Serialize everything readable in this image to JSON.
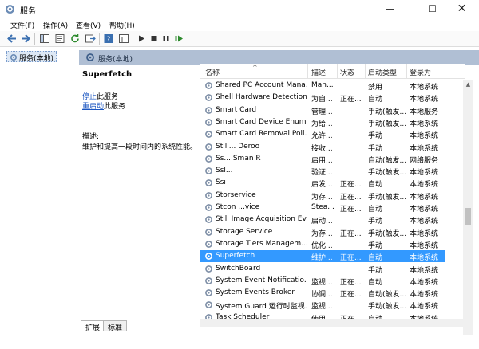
{
  "window": {
    "title": "服务",
    "min": "—",
    "max": "☐",
    "close": "✕"
  },
  "menu": [
    "文件(F)",
    "操作(A)",
    "查看(V)",
    "帮助(H)"
  ],
  "toolbar": {
    "icons": [
      "back-icon",
      "forward-icon",
      "console-tree-icon",
      "properties-icon",
      "refresh-icon",
      "export-icon",
      "help-icon",
      "view-icon",
      "start-icon",
      "stop-icon",
      "pause-icon",
      "restart-icon"
    ]
  },
  "tree": {
    "item": "服务(本地)"
  },
  "pane": {
    "header": "服务(本地)"
  },
  "details": {
    "title": "Superfetch",
    "stop_link": "停止",
    "stop_suffix": "此服务",
    "restart_link": "重启动",
    "restart_suffix": "此服务",
    "desc_label": "描述:",
    "desc_text": "维护和提高一段时间内的系统性能。"
  },
  "columns": {
    "name": "名称",
    "desc": "描述",
    "status": "状态",
    "startup": "启动类型",
    "logon": "登录为"
  },
  "rows": [
    {
      "name": "Shared PC Account Mana...",
      "desc": "Man...",
      "status": "",
      "startup": "禁用",
      "logon": "本地系统"
    },
    {
      "name": "Shell Hardware Detection",
      "desc": "为自...",
      "status": "正在...",
      "startup": "自动",
      "logon": "本地系统"
    },
    {
      "name": "Smart Card",
      "desc": "管理...",
      "status": "",
      "startup": "手动(触发...",
      "logon": "本地服务"
    },
    {
      "name": "Smart Card Device Enum...",
      "desc": "为给...",
      "status": "",
      "startup": "手动(触发...",
      "logon": "本地系统"
    },
    {
      "name": "Smart Card Removal Poli...",
      "desc": "允许...",
      "status": "",
      "startup": "手动",
      "logon": "本地系统"
    },
    {
      "name": "Still...  Deroo",
      "desc": "接收...",
      "status": "",
      "startup": "手动",
      "logon": "本地系统"
    },
    {
      "name": "Ss...  Sman R",
      "desc": "启用...",
      "status": "",
      "startup": "自动(触发...",
      "logon": "网络服务"
    },
    {
      "name": "Ssl...",
      "desc": "验证...",
      "status": "",
      "startup": "手动(触发...",
      "logon": "本地系统"
    },
    {
      "name": "   Ssı",
      "desc": "启发...",
      "status": "正在...",
      "startup": "自动",
      "logon": "本地系统"
    },
    {
      "name": "   Storservice",
      "desc": "为存...",
      "status": "正在...",
      "startup": "手动(触发...",
      "logon": "本地系统"
    },
    {
      "name": "Stcon  ...vice",
      "desc": "Stea...",
      "status": "正在...",
      "startup": "自动",
      "logon": "本地系统"
    },
    {
      "name": "Still Image Acquisition Ev...",
      "desc": "启动...",
      "status": "",
      "startup": "手动",
      "logon": "本地系统"
    },
    {
      "name": "Storage Service",
      "desc": "为存...",
      "status": "正在...",
      "startup": "手动(触发...",
      "logon": "本地系统"
    },
    {
      "name": "Storage Tiers Managem...",
      "desc": "优化...",
      "status": "",
      "startup": "手动",
      "logon": "本地系统"
    },
    {
      "name": "Superfetch",
      "desc": "维护...",
      "status": "正在...",
      "startup": "自动",
      "logon": "本地系统",
      "selected": true
    },
    {
      "name": "SwitchBoard",
      "desc": "",
      "status": "",
      "startup": "手动",
      "logon": "本地系统"
    },
    {
      "name": "System Event Notificatio...",
      "desc": "监视...",
      "status": "正在...",
      "startup": "自动",
      "logon": "本地系统"
    },
    {
      "name": "System Events Broker",
      "desc": "协调...",
      "status": "正在...",
      "startup": "自动(触发...",
      "logon": "本地系统"
    },
    {
      "name": "System Guard 运行时监视...",
      "desc": "监视...",
      "status": "",
      "startup": "手动(触发...",
      "logon": "本地系统"
    },
    {
      "name": "Task Scheduler",
      "desc": "使用...",
      "status": "正在...",
      "startup": "自动",
      "logon": "本地系统"
    }
  ],
  "tabs": [
    "扩展",
    "标准"
  ]
}
